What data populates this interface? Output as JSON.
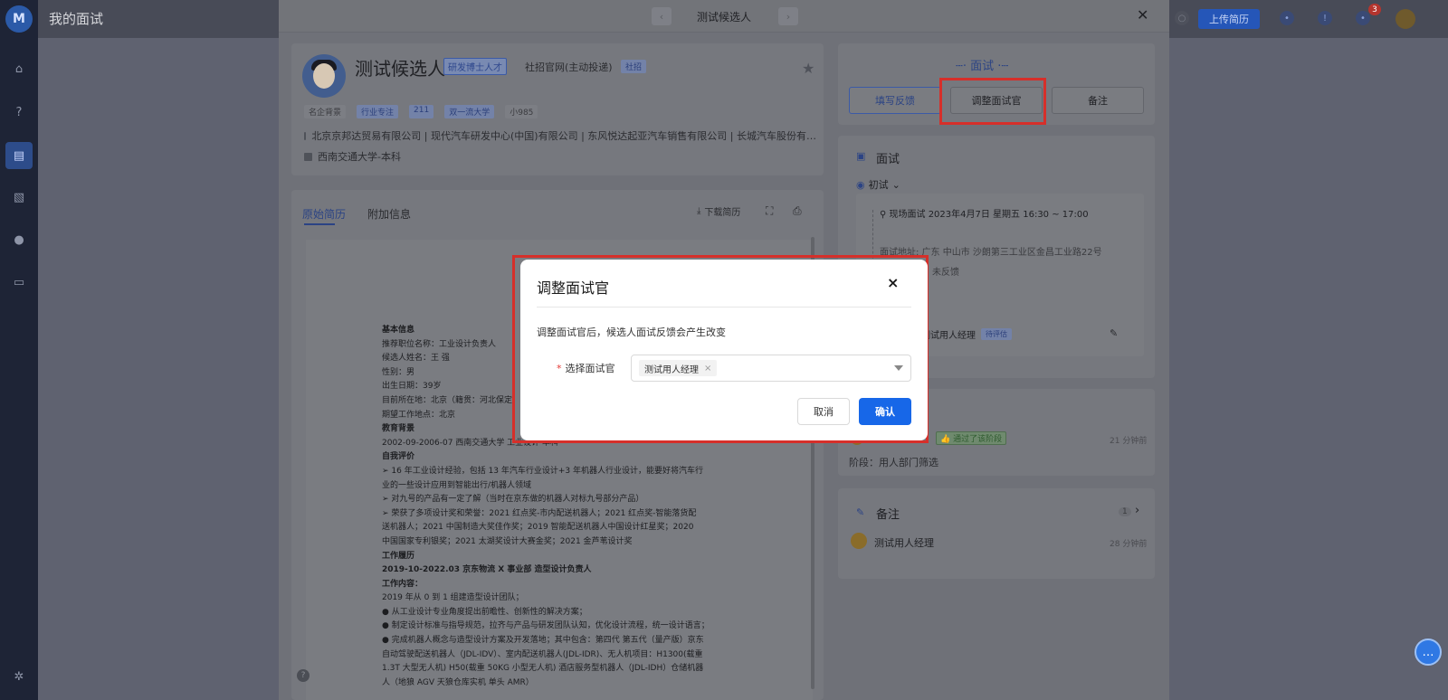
{
  "page": {
    "title": "我的面试"
  },
  "topbar": {
    "upload_label": "上传简历",
    "badge_count": "3"
  },
  "sidebar": {
    "logo_text": "M"
  },
  "drawer": {
    "title": "测试候选人",
    "candidate": {
      "name": "测试候选人",
      "tag_phd": "研发博士人才",
      "source": "社招官网(主动投递)",
      "channel_tag": "社招",
      "chips": [
        "名企背景",
        "行业专注",
        "211",
        "双一流大学",
        "小985"
      ],
      "companies": "北京京邦达贸易有限公司 | 现代汽车研发中心(中国)有限公司 | 东风悦达起亚汽车销售有限公司 | 长城汽车股份有…",
      "school": "西南交通大学-本科"
    },
    "tabs": {
      "original": "原始简历",
      "extra": "附加信息"
    },
    "resume_actions": {
      "download": "下载简历"
    },
    "resume": {
      "lines": [
        {
          "t": "基本信息",
          "b": true
        },
        {
          "t": "推荐职位名称：工业设计负责人",
          "b": false
        },
        {
          "t": "候选人姓名：王 强",
          "b": false
        },
        {
          "t": "性别：男",
          "b": false
        },
        {
          "t": "出生日期：39岁",
          "b": false
        },
        {
          "t": "目前所在地：北京（籍贯：河北保定）",
          "b": false
        },
        {
          "t": "期望工作地点：北京",
          "b": false
        },
        {
          "t": "教育背景",
          "b": true
        },
        {
          "t": "2002-09-2006-07      西南交通大学        工业设计        本科",
          "b": false
        },
        {
          "t": "自我评价",
          "b": true
        },
        {
          "t": "➢  16 年工业设计经验，包括 13 年汽车行业设计+3 年机器人行业设计，能要好将汽车行",
          "b": false
        },
        {
          "t": "    业的一些设计应用到智能出行/机器人领域",
          "b": false
        },
        {
          "t": "➢  对九号的产品有一定了解（当时在京东做的机器人对标九号部分产品）",
          "b": false
        },
        {
          "t": "➢  荣获了多项设计奖和荣誉：2021 红点奖-市内配送机器人；2021 红点奖-智能落货配",
          "b": false
        },
        {
          "t": "    送机器人；2021 中国制造大奖佳作奖；2019 智能配送机器人中国设计红星奖；2020",
          "b": false
        },
        {
          "t": "    中国国家专利银奖；2021 太湖奖设计大赛金奖；2021 金芦苇设计奖",
          "b": false
        },
        {
          "t": "工作履历",
          "b": true
        },
        {
          "t": "2019-10-2022.03      京东物流 X 事业部        造型设计负责人",
          "b": true
        },
        {
          "t": "工作内容：",
          "b": true
        },
        {
          "t": "2019 年从 0 到 1 组建造型设计团队；",
          "b": false
        },
        {
          "t": "●  从工业设计专业角度提出前瞻性、创新性的解决方案；",
          "b": false
        },
        {
          "t": "●  制定设计标准与指导规范，拉齐与产品与研发团队认知，优化设计流程，统一设计语言；",
          "b": false
        },
        {
          "t": "●  完成机器人概念与造型设计方案及开发落地；其中包含：第四代 第五代（量产版）京东",
          "b": false
        },
        {
          "t": "自动驾驶配送机器人（JDL-IDV）、室内配送机器人(JDL-IDR)、无人机项目：H1300(载重",
          "b": false
        },
        {
          "t": "1.3T 大型无人机) H50(载重 50KG 小型无人机) 酒店服务型机器人（JDL-IDH）仓储机器",
          "b": false
        },
        {
          "t": "人（地狼 AGV 天狼仓库实机 单头 AMR）",
          "b": false
        }
      ]
    }
  },
  "right": {
    "section_title": "面试",
    "buttons": {
      "feedback": "填写反馈",
      "adjust": "调整面试官",
      "note": "备注"
    },
    "interview": {
      "title": "面试",
      "round": "初试",
      "time": "现场面试 2023年4月7日 星期五 16:30 ~ 17:00",
      "address": "面试地址: 广东 中山市 沙朗第三工业区金昌工业路22号",
      "status": "未反馈",
      "interviewer": "测试用人经理",
      "interviewer_tag": "待评估"
    },
    "process": {
      "pass_tag": "通过了该阶段",
      "time": "21 分钟前",
      "stage": "阶段：用人部门筛选"
    },
    "notes": {
      "title": "备注",
      "count": "1",
      "author": "测试用人经理",
      "time": "28 分钟前"
    }
  },
  "modal": {
    "title": "调整面试官",
    "description": "调整面试官后，候选人面试反馈会产生改变",
    "field_label": "选择面试官",
    "selected": "测试用人经理",
    "cancel": "取消",
    "confirm": "确认"
  }
}
